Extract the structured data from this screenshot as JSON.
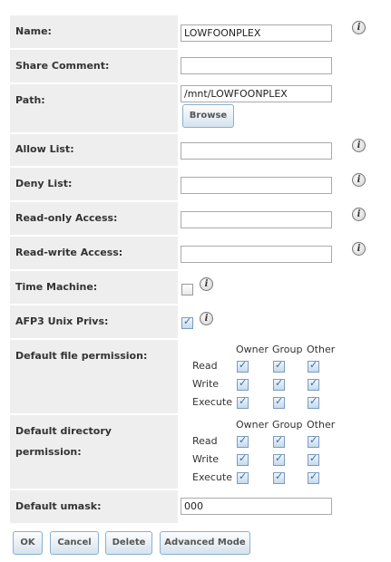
{
  "form": {
    "name": {
      "label": "Name:",
      "value": "LOWFOONPLEX"
    },
    "share_comment": {
      "label": "Share Comment:",
      "value": ""
    },
    "path": {
      "label": "Path:",
      "value": "/mnt/LOWFOONPLEX",
      "browse_label": "Browse"
    },
    "allow_list": {
      "label": "Allow List:",
      "value": ""
    },
    "deny_list": {
      "label": "Deny List:",
      "value": ""
    },
    "read_only": {
      "label": "Read-only Access:",
      "value": ""
    },
    "read_write": {
      "label": "Read-write Access:",
      "value": ""
    },
    "time_machine": {
      "label": "Time Machine:",
      "checked": false
    },
    "afp3_unix_privs": {
      "label": "AFP3 Unix Privs:",
      "checked": true
    },
    "default_file_perm": {
      "label": "Default file permission:",
      "columns": [
        "Owner",
        "Group",
        "Other"
      ],
      "rows": [
        "Read",
        "Write",
        "Execute"
      ]
    },
    "default_dir_perm": {
      "label_line1": "Default directory",
      "label_line2": "permission:",
      "columns": [
        "Owner",
        "Group",
        "Other"
      ],
      "rows": [
        "Read",
        "Write",
        "Execute"
      ]
    },
    "default_umask": {
      "label": "Default umask:",
      "value": "000"
    }
  },
  "info_icon_glyph": "i",
  "buttons": {
    "ok": "OK",
    "cancel": "Cancel",
    "delete": "Delete",
    "advanced": "Advanced Mode"
  }
}
